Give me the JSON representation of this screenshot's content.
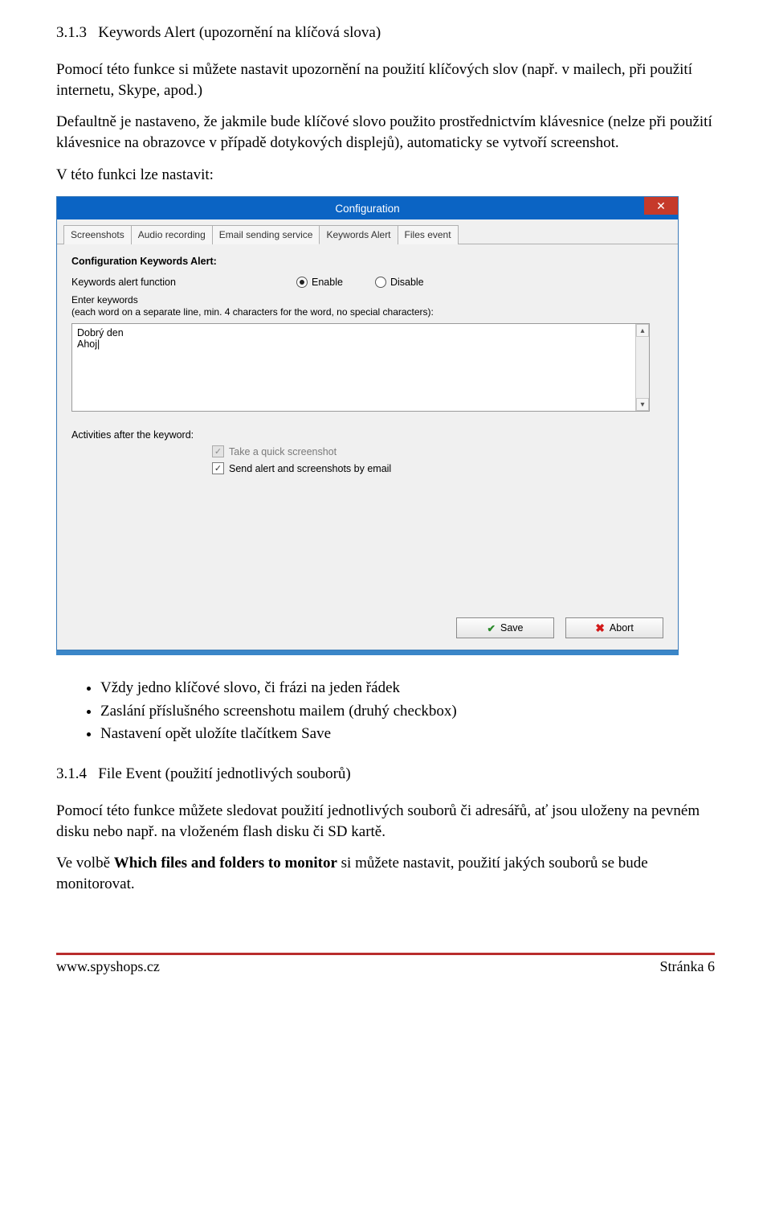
{
  "section_313_number": "3.1.3",
  "section_313_title": "Keywords Alert (upozornění na klíčová slova)",
  "para_313_intro": "Pomocí této funkce si můžete nastavit upozornění na použití klíčových slov (např. v mailech, při použití internetu, Skype, apod.)",
  "para_313_default": "Defaultně je nastaveno, že jakmile bude klíčové slovo použito prostřednictvím klávesnice (nelze při použití klávesnice na obrazovce v případě dotykových displejů), automaticky se vytvoří screenshot.",
  "para_313_canset": "V této funkci lze nastavit:",
  "dialog": {
    "title": "Configuration",
    "close_glyph": "✕",
    "tabs": [
      "Screenshots",
      "Audio recording",
      "Email sending service",
      "Keywords Alert",
      "Files event"
    ],
    "active_tab_index": 3,
    "group_title": "Configuration Keywords Alert:",
    "func_label": "Keywords alert function",
    "radio_enable": "Enable",
    "radio_disable": "Disable",
    "enter_kw_label": "Enter keywords",
    "enter_kw_hint": "(each word on a separate line, min. 4 characters for the word, no special characters):",
    "keywords": [
      "Dobrý den",
      "Ahoj"
    ],
    "activities_label": "Activities after the keyword:",
    "cb_screenshot": "Take a quick screenshot",
    "cb_email": "Send alert and screenshots by email",
    "save_label": "Save",
    "abort_label": "Abort"
  },
  "bullets_313": [
    "Vždy jedno klíčové slovo, či frázi na jeden řádek",
    "Zaslání příslušného screenshotu mailem (druhý checkbox)",
    "Nastavení opět uložíte tlačítkem Save"
  ],
  "section_314_number": "3.1.4",
  "section_314_title": "File Event (použití jednotlivých souborů)",
  "para_314_intro": "Pomocí této funkce můžete sledovat použití jednotlivých souborů či adresářů, ať jsou uloženy na pevném disku nebo např. na vloženém flash disku či SD kartě.",
  "para_314_which_prefix": "Ve volbě ",
  "para_314_which_bold": "Which files and folders to monitor",
  "para_314_which_suffix": " si můžete nastavit, použití jakých souborů se bude monitorovat.",
  "footer_site": "www.spyshops.cz",
  "footer_page": "Stránka 6"
}
